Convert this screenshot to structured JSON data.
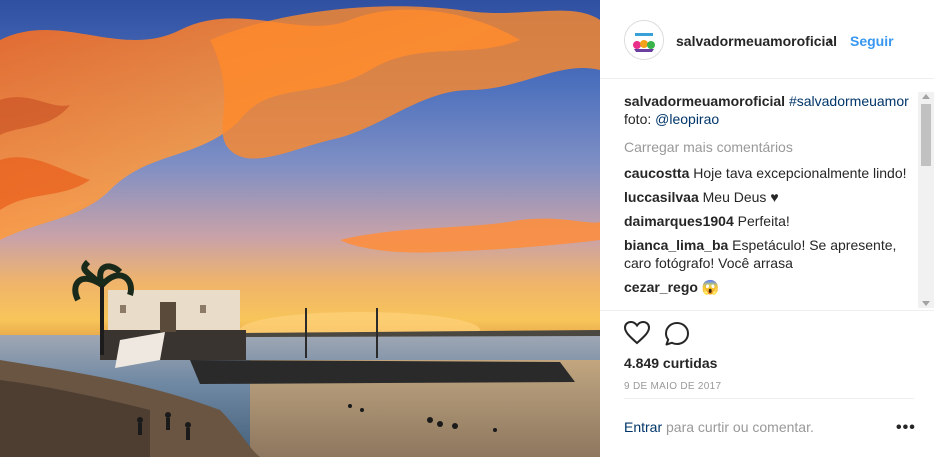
{
  "post": {
    "username": "salvadormeuamoroficial",
    "separator": "•",
    "follow_label": "Seguir"
  },
  "caption": {
    "username": "salvadormeuamoroficial",
    "hashtag": "#salvadormeuamor",
    "text_prefix": "foto:",
    "mention": "@leopirao"
  },
  "load_more_label": "Carregar mais comentários",
  "comments": [
    {
      "user": "caucostta",
      "text": "Hoje tava excepcionalmente lindo!"
    },
    {
      "user": "luccasilvaa",
      "text": "Meu Deus ♥"
    },
    {
      "user": "daimarques1904",
      "text": "Perfeita!"
    },
    {
      "user": "bianca_lima_ba",
      "text": "Espetáculo! Se apresente, caro fotógrafo! Você arrasa"
    },
    {
      "user": "cezar_rego",
      "text": "😱"
    }
  ],
  "likes_label": "4.849 curtidas",
  "date_label": "9 DE MAIO DE 2017",
  "footer": {
    "login_link": "Entrar",
    "login_suffix": " para curtir ou comentar.",
    "more_glyph": "•••"
  },
  "colors": {
    "link_blue": "#3897f0",
    "link_dark": "#003569",
    "muted": "#999999",
    "text": "#262626",
    "border": "#efefef"
  },
  "icons": {
    "like": "heart-icon",
    "comment": "comment-bubble-icon",
    "more": "more-options-icon"
  }
}
